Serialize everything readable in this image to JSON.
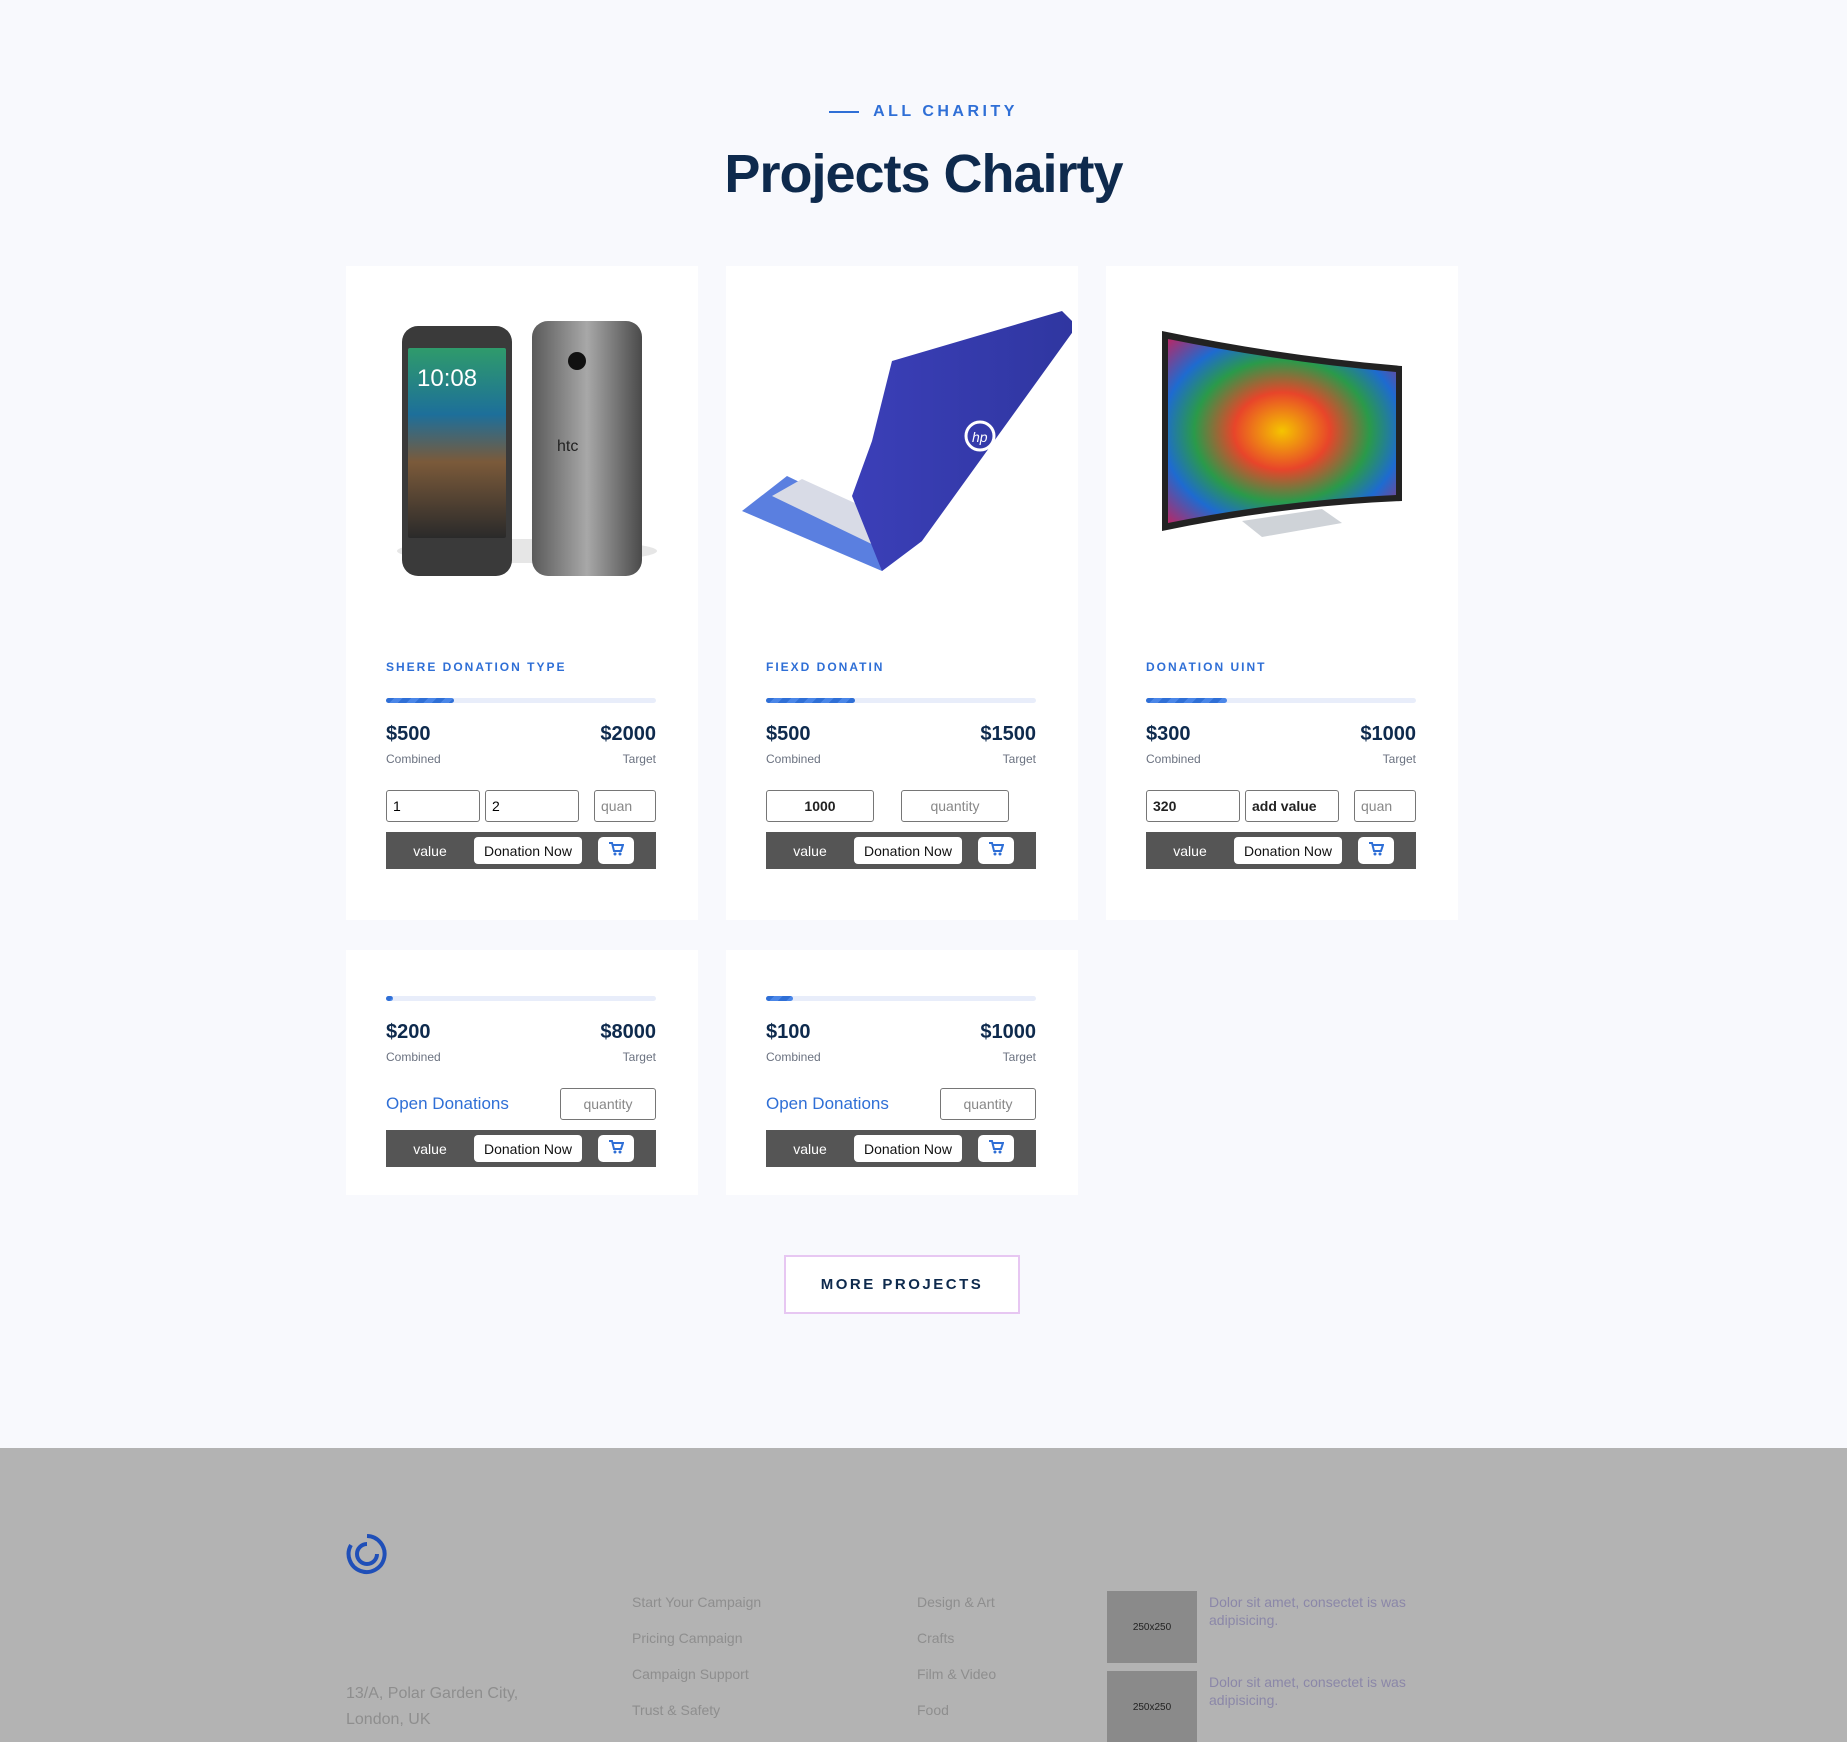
{
  "header": {
    "eyebrow": "ALL CHARITY",
    "title": "Projects Chairty"
  },
  "cards": [
    {
      "type": "SHERE DONATION TYPE",
      "product": "phone",
      "combined": "$500",
      "combined_label": "Combined",
      "target": "$2000",
      "target_label": "Target",
      "progress": 0.25,
      "inputs": [
        "1",
        "2"
      ],
      "input_placeholder": "quan",
      "bar_value": "value",
      "donate_label": "Donation Now"
    },
    {
      "type": "FIEXD DONATIN",
      "product": "laptop",
      "combined": "$500",
      "combined_label": "Combined",
      "target": "$1500",
      "target_label": "Target",
      "progress": 0.33,
      "inputs": [
        "1000"
      ],
      "input_placeholder": "quantity",
      "bar_value": "value",
      "donate_label": "Donation Now"
    },
    {
      "type": "DONATION UINT",
      "product": "tv",
      "combined": "$300",
      "combined_label": "Combined",
      "target": "$1000",
      "target_label": "Target",
      "progress": 0.3,
      "inputs": [
        "320",
        "add value"
      ],
      "input_placeholder": "quan",
      "bar_value": "value",
      "donate_label": "Donation Now"
    },
    {
      "combined": "$200",
      "combined_label": "Combined",
      "target": "$8000",
      "target_label": "Target",
      "progress": 0.025,
      "open_label": "Open Donations",
      "input_placeholder": "quantity",
      "bar_value": "value",
      "donate_label": "Donation Now"
    },
    {
      "combined": "$100",
      "combined_label": "Combined",
      "target": "$1000",
      "target_label": "Target",
      "progress": 0.1,
      "open_label": "Open Donations",
      "input_placeholder": "quantity",
      "bar_value": "value",
      "donate_label": "Donation Now"
    }
  ],
  "more_button": "MORE PROJECTS",
  "footer": {
    "address": [
      "13/A, Polar Garden City,",
      "London, UK"
    ],
    "col1": [
      "Start Your Campaign",
      "Pricing Campaign",
      "Campaign Support",
      "Trust & Safety"
    ],
    "col2": [
      "Design & Art",
      "Crafts",
      "Film & Video",
      "Food"
    ],
    "posts": [
      {
        "thumb": "250x250",
        "text": "Dolor sit amet, consectet is was adipisicing."
      },
      {
        "thumb": "250x250",
        "text": "Dolor sit amet, consectet is was adipisicing."
      }
    ]
  },
  "colors": {
    "accent": "#2f6fd6",
    "heading": "#0e2a4d",
    "dark_bar": "#555555",
    "footer_bg": "#b3b3b3"
  }
}
